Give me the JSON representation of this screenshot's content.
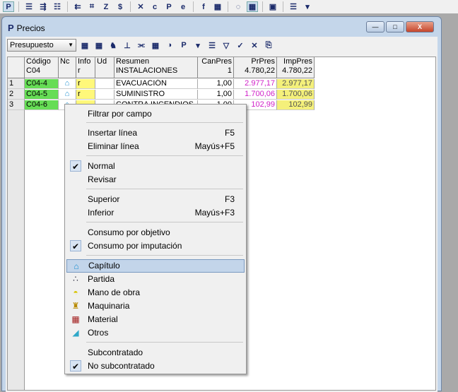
{
  "topbar": {
    "icons": [
      "P",
      "☰",
      "⇶",
      "☷",
      "⇇",
      "⌗",
      "Z",
      "$",
      "✕",
      "c",
      "P",
      "e",
      "f",
      "▦",
      "◌",
      "▦",
      "▣",
      "☰",
      "▾"
    ]
  },
  "window": {
    "title": "Precios",
    "logo": "P",
    "controls": [
      "—",
      "□",
      "X"
    ]
  },
  "toolbar": {
    "select_value": "Presupuesto",
    "icons": [
      "▦",
      "▦",
      "♞",
      "⊥",
      "⫘",
      "▦",
      "◑",
      "P",
      "▾",
      "☰",
      "▽",
      "✓",
      "✕",
      "⎘"
    ]
  },
  "grid": {
    "headers": [
      [
        "",
        "",
        ""
      ],
      [
        "Código",
        "C04"
      ],
      [
        "Nc",
        ""
      ],
      [
        "Info",
        "r"
      ],
      [
        "Ud",
        ""
      ],
      [
        "Resumen",
        "INSTALACIONES"
      ],
      [
        "CanPres",
        "1"
      ],
      [
        "PrPres",
        "4.780,22"
      ],
      [
        "ImpPres",
        "4.780,22"
      ]
    ],
    "rows": [
      {
        "n": "1",
        "codigo": "C04-4",
        "nc": "⌂",
        "info": "r",
        "ud": "",
        "resumen": "EVACUACIÓN",
        "canpres": "1,00",
        "prpres": "2.977,17",
        "imppres": "2.977,17"
      },
      {
        "n": "2",
        "codigo": "C04-5",
        "nc": "⌂",
        "info": "r",
        "ud": "",
        "resumen": "SUMINISTRO",
        "canpres": "1,00",
        "prpres": "1.700,06",
        "imppres": "1.700,06"
      },
      {
        "n": "3",
        "codigo": "C04-6",
        "nc": "⌂",
        "info": "",
        "ud": "",
        "resumen": "CONTRA INCENDIOS",
        "canpres": "1,00",
        "prpres": "102,99",
        "imppres": "102,99"
      }
    ]
  },
  "menu": {
    "items": [
      {
        "label": "Filtrar por campo",
        "shortcut": ""
      },
      {
        "label": "Insertar línea",
        "shortcut": "F5"
      },
      {
        "label": "Eliminar línea",
        "shortcut": "Mayús+F5"
      },
      {
        "label": "Normal",
        "shortcut": "",
        "checked": true
      },
      {
        "label": "Revisar",
        "shortcut": ""
      },
      {
        "label": "Superior",
        "shortcut": "F3"
      },
      {
        "label": "Inferior",
        "shortcut": "Mayús+F3"
      },
      {
        "label": "Consumo por objetivo",
        "shortcut": ""
      },
      {
        "label": "Consumo por imputación",
        "shortcut": "",
        "checked": true
      },
      {
        "label": "Capítulo",
        "icon": "⌂",
        "highlighted": true
      },
      {
        "label": "Partida",
        "icon": "∴"
      },
      {
        "label": "Mano de obra",
        "icon": "◓"
      },
      {
        "label": "Maquinaria",
        "icon": "♜"
      },
      {
        "label": "Material",
        "icon": "▦"
      },
      {
        "label": "Otros",
        "icon": "◢"
      },
      {
        "label": "Subcontratado"
      },
      {
        "label": "No subcontratado",
        "checked": true
      }
    ],
    "check_glyph": "✔"
  }
}
